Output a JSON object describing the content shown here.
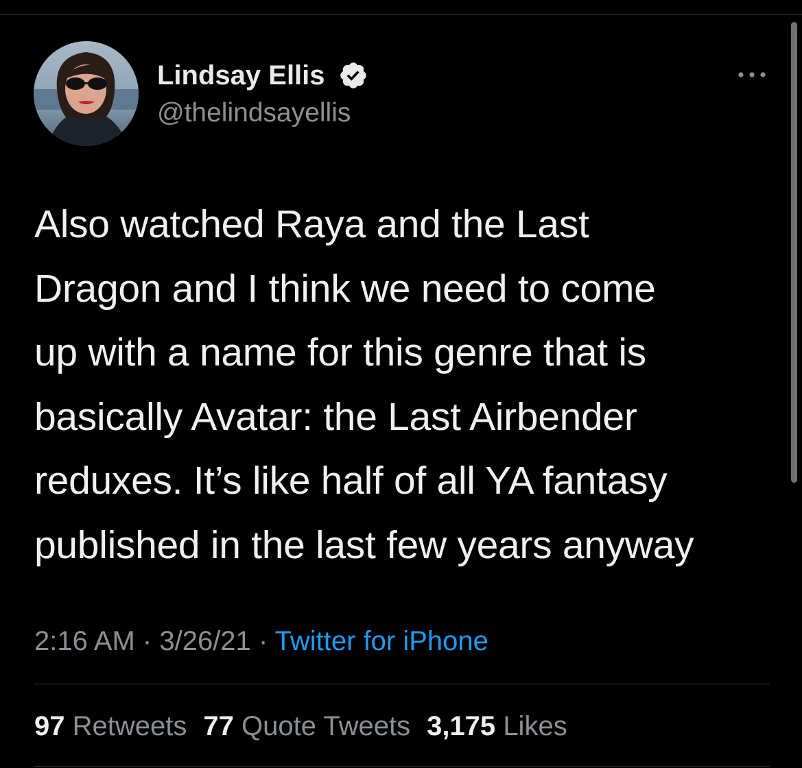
{
  "author": {
    "display_name": "Lindsay Ellis",
    "handle": "@thelindsayellis",
    "verified": true,
    "avatar_icon": "profile-photo"
  },
  "tweet": {
    "text_lines": [
      "Also watched Raya and the Last",
      "Dragon and I think we need to come",
      "up with a name for this genre that is",
      "basically Avatar: the Last Airbender",
      "reduxes. It’s like half of all YA fantasy",
      "published in the last few years anyway"
    ],
    "time": "2:16 AM",
    "date": "3/26/21",
    "separator": "·",
    "source": "Twitter for iPhone"
  },
  "stats": {
    "retweets_count": "97",
    "retweets_label": "Retweets",
    "quotes_count": "77",
    "quotes_label": "Quote Tweets",
    "likes_count": "3,175",
    "likes_label": "Likes"
  },
  "colors": {
    "background": "#000000",
    "primary_text": "#e7e9ea",
    "secondary_text": "#8b9095",
    "link": "#1d9bf0",
    "divider": "#2f3336"
  },
  "icons": {
    "verified": "verified-badge-icon",
    "more": "more-options-icon"
  }
}
